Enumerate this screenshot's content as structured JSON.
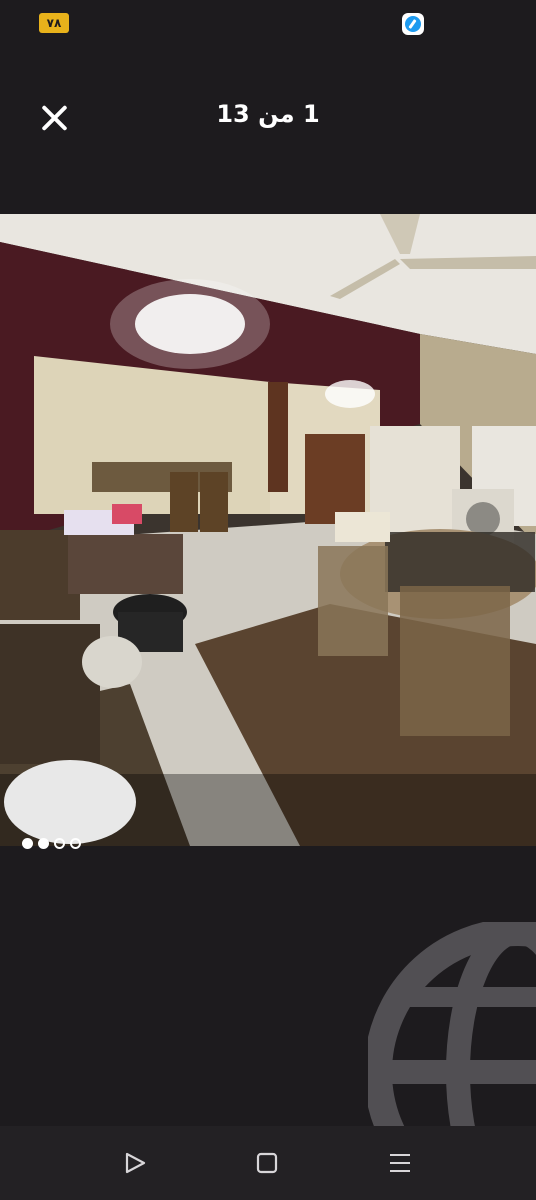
{
  "status_bar": {
    "battery_text": "٧٨",
    "app_icon": "app-circle-icon"
  },
  "header": {
    "close_icon": "close-icon",
    "counter_text": "1 من 13"
  },
  "photo": {
    "description_icon": "room-photo"
  },
  "pager": {
    "dots": [
      "active",
      "active",
      "inactive",
      "inactive"
    ]
  },
  "watermark": {
    "icon": "globe-icon"
  },
  "nav_bar": {
    "back_icon": "back-triangle-icon",
    "home_icon": "home-square-icon",
    "recents_icon": "recents-lines-icon"
  }
}
